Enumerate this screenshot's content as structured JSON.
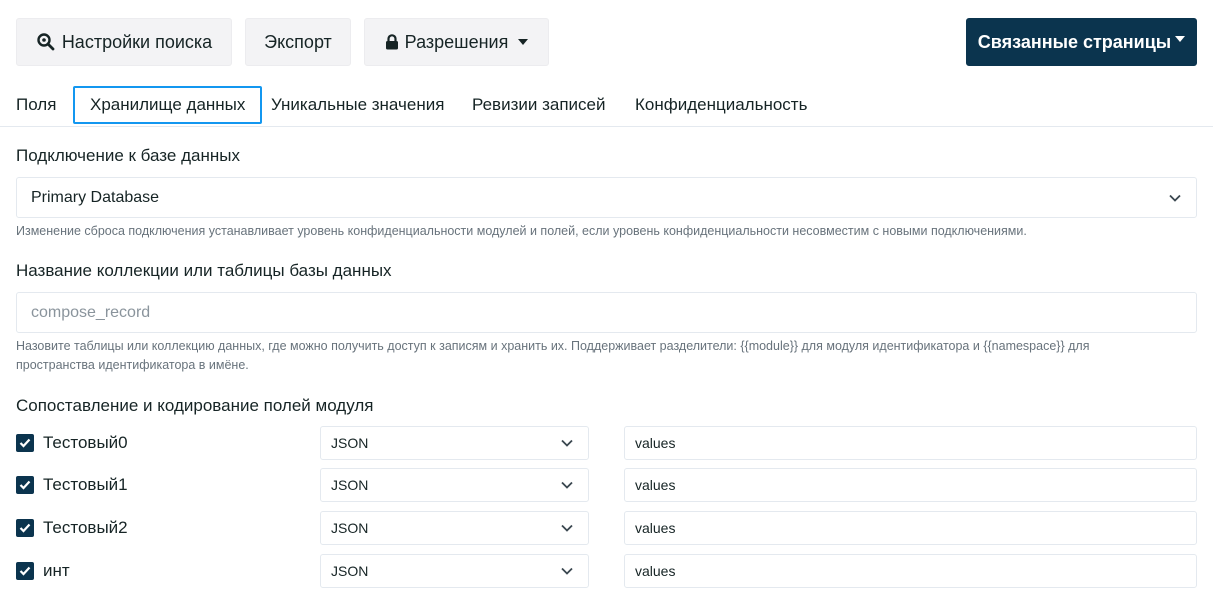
{
  "toolbar": {
    "search_settings": "Настройки поиска",
    "export": "Экспорт",
    "permissions": "Разрешения",
    "related_pages": "Связанные страницы"
  },
  "tabs": [
    {
      "label": "Поля",
      "active": false
    },
    {
      "label": "Хранилище данных",
      "active": true
    },
    {
      "label": "Уникальные значения",
      "active": false
    },
    {
      "label": "Ревизии записей",
      "active": false
    },
    {
      "label": "Конфиденциальность",
      "active": false
    }
  ],
  "connection": {
    "label": "Подключение к базе данных",
    "value": "Primary Database",
    "help": "Изменение сброса подключения устанавливает уровень конфиденциальности модулей и полей, если уровень конфиденциальности несовместим с новыми подключениями."
  },
  "collection": {
    "label": "Название коллекции или таблицы базы данных",
    "placeholder": "compose_record",
    "help_line1": "Назовите таблицы или коллекцию данных, где можно получить доступ к записям и хранить их. Поддерживает разделители: {{module}} для модуля идентификатора и {{namespace}} для",
    "help_line2": "пространства идентификатора в имёне."
  },
  "mapping": {
    "label": "Сопоставление и кодирование полей модуля",
    "fields": [
      {
        "name": "Тестовый0",
        "encoding": "JSON",
        "column": "values",
        "checked": true
      },
      {
        "name": "Тестовый1",
        "encoding": "JSON",
        "column": "values",
        "checked": true
      },
      {
        "name": "Тестовый2",
        "encoding": "JSON",
        "column": "values",
        "checked": true
      },
      {
        "name": "инт",
        "encoding": "JSON",
        "column": "values",
        "checked": true
      }
    ]
  },
  "colors": {
    "primary": "#0b344e",
    "tab_active_border": "#1397f0",
    "button_bg": "#f3f3f5",
    "border": "#e4e9ef"
  }
}
